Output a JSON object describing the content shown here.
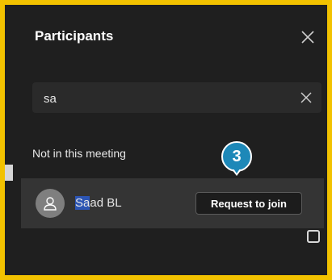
{
  "panel": {
    "title": "Participants",
    "close_icon": "close-icon"
  },
  "search": {
    "value": "sa",
    "clear_icon": "close-icon"
  },
  "section": {
    "label": "Not in this meeting"
  },
  "participants": [
    {
      "name_highlight": "Sa",
      "name_rest": "ad BL",
      "avatar_icon": "person-icon",
      "action_label": "Request to join"
    }
  ],
  "step_badge": {
    "number": "3"
  },
  "colors": {
    "frame_border": "#f2c200",
    "panel_bg": "#1f1f1f",
    "row_bg": "#343434",
    "badge_bg": "#1d88b8",
    "highlight": "#2c55b4"
  }
}
